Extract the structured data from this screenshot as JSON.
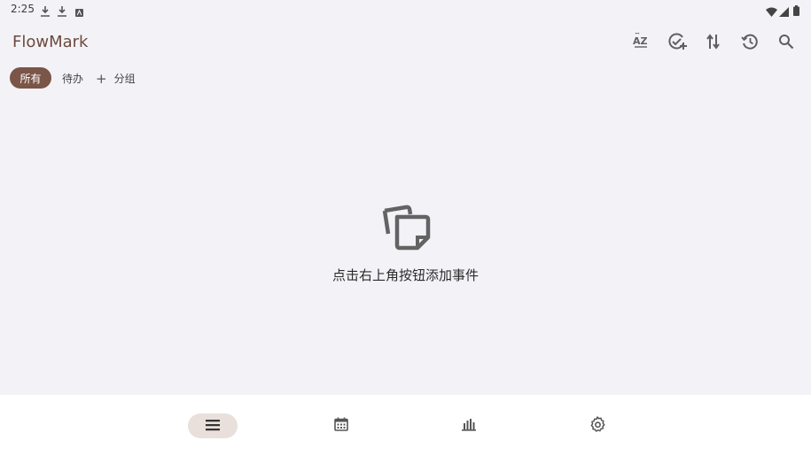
{
  "status_bar": {
    "time": "2:25",
    "left_icons": [
      "download-icon",
      "download-icon",
      "app-notification-icon"
    ],
    "right_icons": [
      "wifi-icon",
      "signal-icon",
      "battery-icon"
    ]
  },
  "app": {
    "title": "FlowMark",
    "actions": [
      {
        "name": "sort-az-icon",
        "label": "AZ"
      },
      {
        "name": "add-done-icon"
      },
      {
        "name": "swap-vert-icon"
      },
      {
        "name": "history-icon"
      },
      {
        "name": "search-icon"
      }
    ]
  },
  "filters": {
    "all": "所有",
    "todo": "待办",
    "add_group": "分组",
    "add_symbol": "+"
  },
  "empty_state": {
    "icon": "notes-stack-icon",
    "message": "点击右上角按钮添加事件"
  },
  "bottom_nav": [
    {
      "name": "list-icon",
      "active": true
    },
    {
      "name": "calendar-icon",
      "active": false
    },
    {
      "name": "bar-chart-icon",
      "active": false
    },
    {
      "name": "settings-icon",
      "active": false
    }
  ],
  "colors": {
    "accent": "#7a5548",
    "background": "#f3f2f7",
    "nav_active": "#e9dfdb",
    "icon": "#5f5f5f"
  }
}
